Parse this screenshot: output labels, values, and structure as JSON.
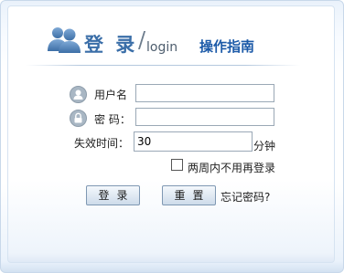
{
  "header": {
    "title_cn": "登 录",
    "slash": "/",
    "title_en": "login",
    "guide_link": "操作指南"
  },
  "form": {
    "username_label": "用户名",
    "password_label": "密 码：",
    "expire_label": "失效时间：",
    "expire_value": "30",
    "expire_unit": "分钟",
    "remember_label": "两周内不用再登录",
    "remember_checked": false
  },
  "buttons": {
    "login": "登录",
    "reset": "重置",
    "forgot": "忘记密码?"
  },
  "colors": {
    "title": "#3a6ea8",
    "link": "#1c5aa8"
  }
}
